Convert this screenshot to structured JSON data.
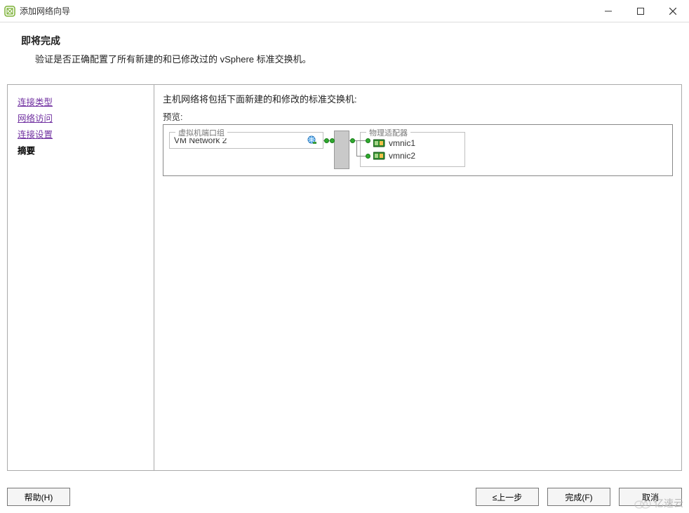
{
  "window": {
    "title": "添加网络向导"
  },
  "header": {
    "heading": "即将完成",
    "description": "验证是否正确配置了所有新建的和已修改过的 vSphere 标准交换机。"
  },
  "sidebar": {
    "steps": [
      {
        "label": "连接类型",
        "current": false
      },
      {
        "label": "网络访问",
        "current": false
      },
      {
        "label": "连接设置",
        "current": false
      },
      {
        "label": "摘要",
        "current": true
      }
    ]
  },
  "content": {
    "intro": "主机网络将包括下面新建的和修改的标准交换机:",
    "preview_label": "预览:",
    "port_group": {
      "legend": "虚拟机端口组",
      "name": "VM Network 2"
    },
    "physical_adapter": {
      "legend": "物理适配器",
      "nics": [
        "vmnic1",
        "vmnic2"
      ]
    }
  },
  "footer": {
    "help": "帮助(H)",
    "back": "≤上一步",
    "finish": "完成(F)",
    "cancel": "取消"
  },
  "watermark": "亿速云"
}
